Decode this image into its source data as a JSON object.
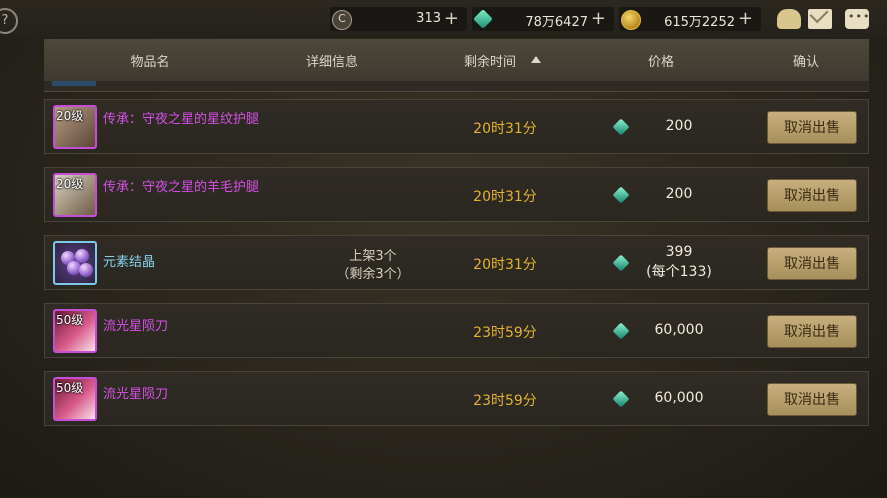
{
  "topbar": {
    "currencies": [
      {
        "icon": "c-coin-icon",
        "value": "313",
        "plus": "+"
      },
      {
        "icon": "gem-icon",
        "value": "78万6427",
        "plus": "+"
      },
      {
        "icon": "gold-coin-icon",
        "value": "615万2252",
        "plus": "+"
      }
    ],
    "help": "?"
  },
  "header": {
    "name": "物品名",
    "detail": "详细信息",
    "time": "剩余时间",
    "price": "价格",
    "confirm": "确认"
  },
  "rows": [
    {
      "level": "20级",
      "name": "传承：守夜之星的星纹护腿",
      "detail1": "",
      "detail2": "",
      "time": "20时31分",
      "price": "200",
      "price_sub": "",
      "button": "取消出售",
      "rarity": "purple"
    },
    {
      "level": "20级",
      "name": "传承：守夜之星的羊毛护腿",
      "detail1": "",
      "detail2": "",
      "time": "20时31分",
      "price": "200",
      "price_sub": "",
      "button": "取消出售",
      "rarity": "purple"
    },
    {
      "level": "",
      "name": "元素结晶",
      "detail1": "上架3个",
      "detail2": "（剩余3个）",
      "time": "20时31分",
      "price": "399",
      "price_sub": "(每个133)",
      "button": "取消出售",
      "rarity": "blue"
    },
    {
      "level": "50级",
      "name": "流光星陨刀",
      "detail1": "",
      "detail2": "",
      "time": "23时59分",
      "price": "60,000",
      "price_sub": "",
      "button": "取消出售",
      "rarity": "purple"
    },
    {
      "level": "50级",
      "name": "流光星陨刀",
      "detail1": "",
      "detail2": "",
      "time": "23时59分",
      "price": "60,000",
      "price_sub": "",
      "button": "取消出售",
      "rarity": "purple"
    }
  ],
  "colors": {
    "time": "#e3b234",
    "purple_name": "#d64fe6",
    "blue_name": "#86d2ef",
    "button": "#b89f6a"
  }
}
